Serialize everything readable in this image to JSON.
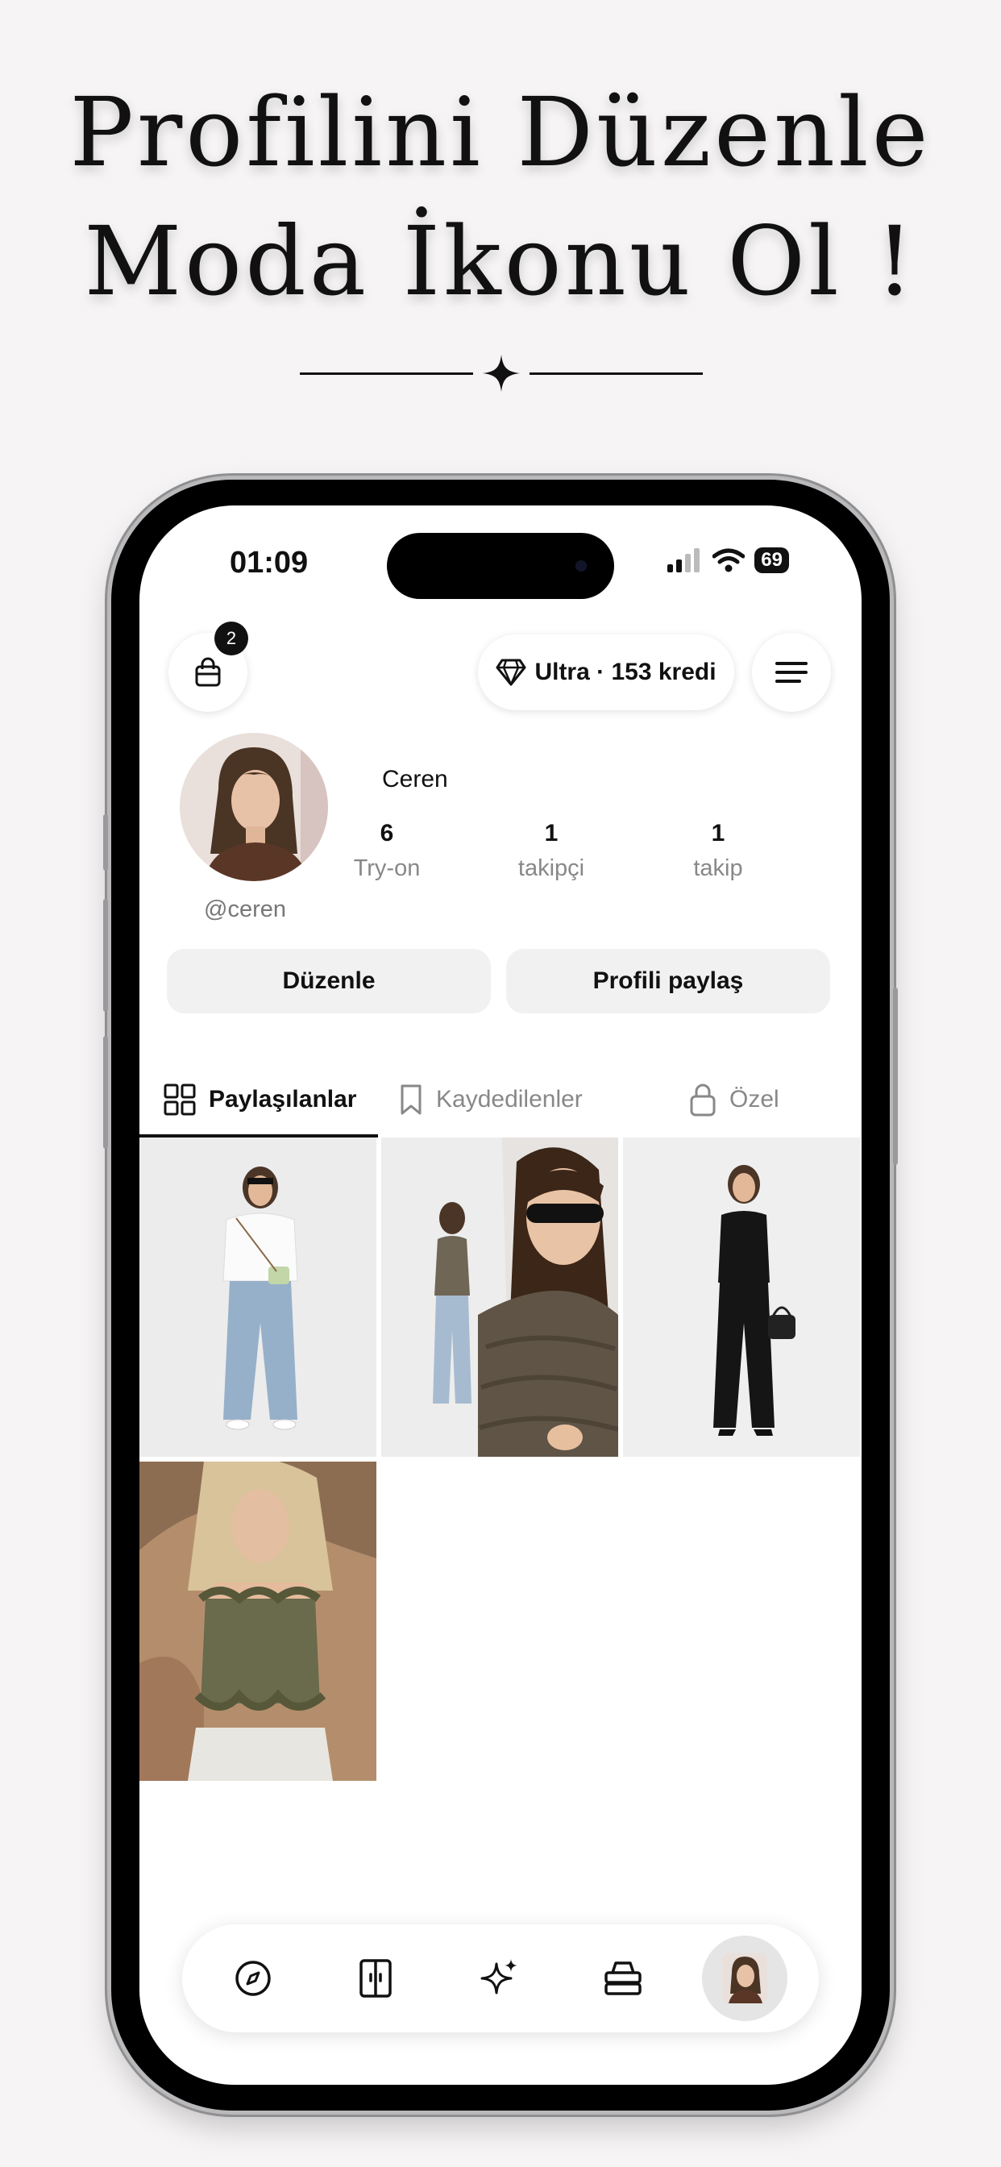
{
  "marketing": {
    "headline_line1": "Profilini Düzenle",
    "headline_line2": "Moda İkonu Ol !"
  },
  "status_bar": {
    "time": "01:09",
    "battery": "69"
  },
  "header": {
    "cart_badge_count": "2",
    "credit_label": "Ultra · 153 kredi"
  },
  "profile": {
    "name": "Ceren",
    "handle": "@ceren",
    "stats": [
      {
        "value": "6",
        "label": "Try-on"
      },
      {
        "value": "1",
        "label": "takipçi"
      },
      {
        "value": "1",
        "label": "takip"
      }
    ],
    "edit_button": "Düzenle",
    "share_button": "Profili paylaş"
  },
  "tabs": [
    {
      "label": "Paylaşılanlar",
      "icon": "grid-icon",
      "active": true
    },
    {
      "label": "Kaydedilenler",
      "icon": "bookmark-icon",
      "active": false
    },
    {
      "label": "Özel",
      "icon": "lock-icon",
      "active": false
    }
  ],
  "posts": [
    {
      "name": "post-white-shirt-jeans"
    },
    {
      "name": "post-ruffle-halter-top"
    },
    {
      "name": "post-black-vest-suit"
    },
    {
      "name": "post-olive-corset-top"
    }
  ],
  "bottom_nav": [
    {
      "icon": "compass-icon"
    },
    {
      "icon": "wardrobe-icon"
    },
    {
      "icon": "sparkles-icon"
    },
    {
      "icon": "clothes-stack-icon"
    },
    {
      "icon": "profile-avatar-icon"
    }
  ],
  "colors": {
    "background": "#f6f4f4",
    "accent": "#111111",
    "muted_text": "#888888"
  }
}
